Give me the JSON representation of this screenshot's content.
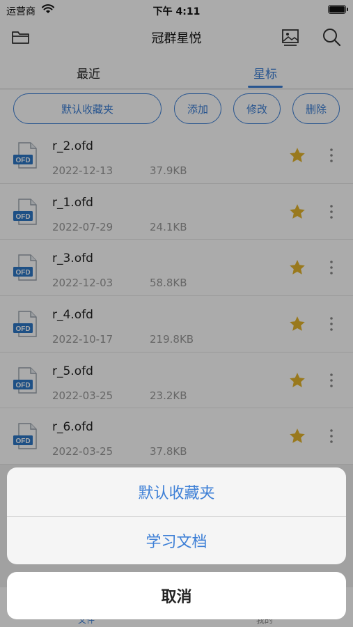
{
  "status": {
    "carrier": "运营商",
    "time": "下午 4:11"
  },
  "nav": {
    "title": "冠群星悦"
  },
  "tabs": {
    "recent": "最近",
    "starred": "星标"
  },
  "chips": {
    "default_folder": "默认收藏夹",
    "add": "添加",
    "edit": "修改",
    "delete": "删除"
  },
  "files": [
    {
      "name": "r_2.ofd",
      "date": "2022-12-13",
      "size": "37.9KB",
      "icon_label": "OFD"
    },
    {
      "name": "r_1.ofd",
      "date": "2022-07-29",
      "size": "24.1KB",
      "icon_label": "OFD"
    },
    {
      "name": "r_3.ofd",
      "date": "2022-12-03",
      "size": "58.8KB",
      "icon_label": "OFD"
    },
    {
      "name": "r_4.ofd",
      "date": "2022-10-17",
      "size": "219.8KB",
      "icon_label": "OFD"
    },
    {
      "name": "r_5.ofd",
      "date": "2022-03-25",
      "size": "23.2KB",
      "icon_label": "OFD"
    },
    {
      "name": "r_6.ofd",
      "date": "2022-03-25",
      "size": "37.8KB",
      "icon_label": "OFD"
    }
  ],
  "bottom_tabs": {
    "files": "文件",
    "mine": "我的"
  },
  "action_sheet": {
    "items": [
      "默认收藏夹",
      "学习文档"
    ],
    "cancel": "取消"
  },
  "colors": {
    "accent": "#3d7fd6",
    "star": "#e5b52c"
  }
}
